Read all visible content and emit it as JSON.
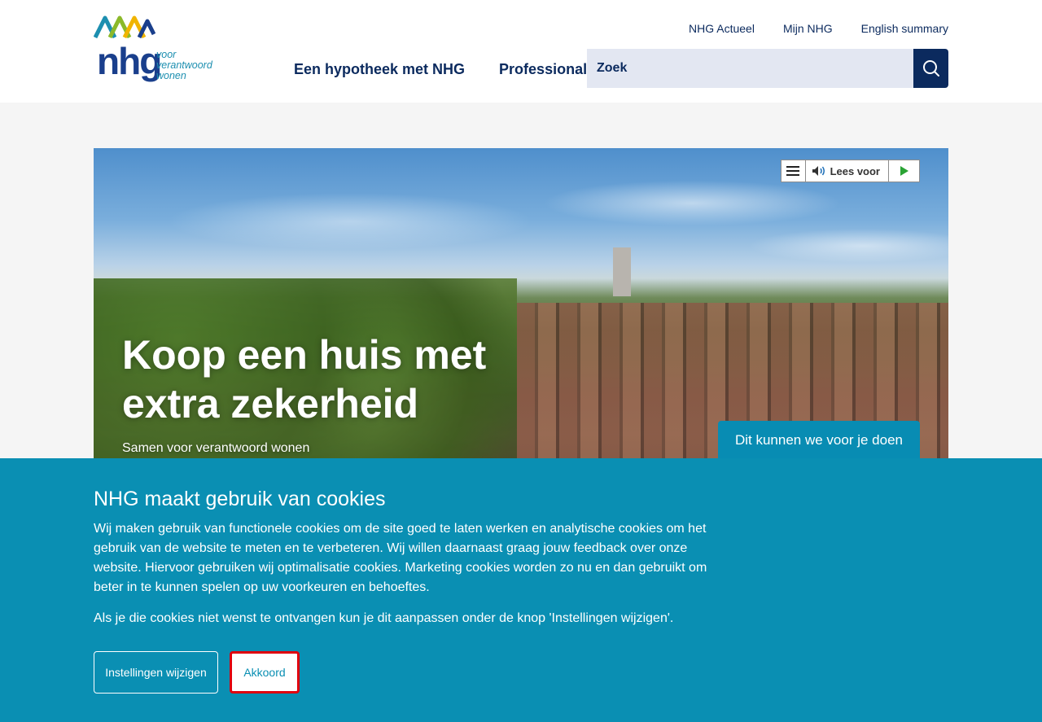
{
  "logo": {
    "word": "nhg",
    "tagline": [
      "voor",
      "verantwoord",
      "wonen"
    ],
    "colors": [
      "#1d8fb0",
      "#8bb92a",
      "#f0b400",
      "#1a3f8c"
    ]
  },
  "utility_nav": [
    "NHG Actueel",
    "Mijn NHG",
    "English summary"
  ],
  "main_nav": [
    "Een hypotheek met NHG",
    "Professional"
  ],
  "search": {
    "placeholder": "Zoek",
    "button_icon": "search-icon"
  },
  "readspeaker": {
    "menu_icon": "menu-icon",
    "speaker_icon": "speaker-icon",
    "label": "Lees voor",
    "play_icon": "play-icon"
  },
  "hero": {
    "title": "Koop een huis met extra zekerheid",
    "subtitle": "Samen voor verantwoord wonen",
    "cta": "Dit kunnen we voor je doen"
  },
  "cookie_banner": {
    "title": "NHG maakt gebruik van cookies",
    "paragraph1": "Wij maken gebruik van functionele cookies om de site goed te laten werken en analytische cookies om het gebruik van de website te meten en te verbeteren. Wij willen daarnaast graag jouw feedback over onze website. Hiervoor gebruiken wij optimalisatie cookies. Marketing cookies worden zo nu en dan gebruikt om beter in te kunnen spelen op uw voorkeuren en behoeftes.",
    "paragraph2": "Als je die cookies niet wenst te ontvangen kun je dit aanpassen onder de knop 'Instellingen wijzigen'.",
    "settings_button": "Instellingen wijzigen",
    "accept_button": "Akkoord"
  },
  "colors": {
    "navy": "#0b2a5e",
    "teal": "#0a8fb3",
    "highlight": "#e0000e"
  }
}
